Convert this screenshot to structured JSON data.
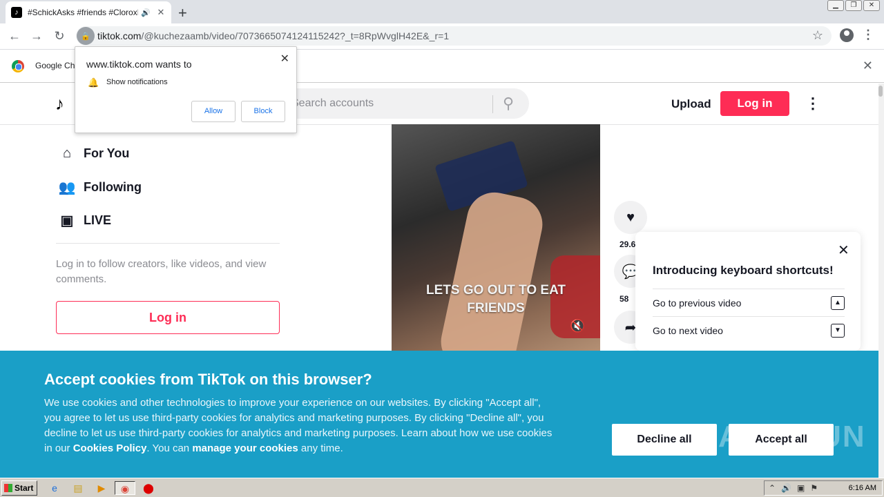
{
  "browser": {
    "tab_title": "#SchickAsks #friends #CloroxM",
    "tab_favicon": "tiktok-icon",
    "url_main": "tiktok.com",
    "url_path": "/@kuchezaamb/video/7073665074124115242?_t=8RpWvglH42E&_r=1",
    "window_controls": [
      "minimize-icon",
      "restore-icon",
      "close-icon"
    ]
  },
  "infobar": {
    "text": "Google Ch"
  },
  "permission_popup": {
    "title": "www.tiktok.com wants to",
    "item": "Show notifications",
    "allow": "Allow",
    "block": "Block"
  },
  "header": {
    "search_placeholder": "Search accounts",
    "upload": "Upload",
    "login": "Log in"
  },
  "sidebar": {
    "items": [
      {
        "label": "For You",
        "icon": "home-icon"
      },
      {
        "label": "Following",
        "icon": "people-icon"
      },
      {
        "label": "LIVE",
        "icon": "live-video-icon"
      }
    ],
    "note": "Log in to follow creators, like videos, and view comments.",
    "login": "Log in"
  },
  "video": {
    "caption_line1": "LETS GO OUT TO EAT",
    "caption_line2": "FRIENDS",
    "likes": "29.6",
    "comments": "58"
  },
  "shortcuts": {
    "title": "Introducing keyboard shortcuts!",
    "rows": [
      {
        "label": "Go to previous video",
        "key": "▲"
      },
      {
        "label": "Go to next video",
        "key": "▼"
      }
    ]
  },
  "cookie": {
    "title": "Accept cookies from TikTok on this browser?",
    "body_1": "We use cookies and other technologies to improve your experience on our websites. By clicking \"Accept all\", you agree to let us use third-party cookies for analytics and marketing purposes. By clicking \"Decline all\", you decline to let us use third-party cookies for analytics and marketing purposes. Learn about how we use cookies in our ",
    "policy_link": "Cookies Policy",
    "body_2": ". You can ",
    "manage_link": "manage your cookies",
    "body_3": " any time.",
    "decline": "Decline all",
    "accept": "Accept all",
    "watermark": "ANY RUN"
  },
  "taskbar": {
    "start": "Start",
    "clock": "6:16 AM"
  },
  "colors": {
    "tiktok_red": "#fe2c55",
    "cookie_bg": "#1a9fc7"
  }
}
